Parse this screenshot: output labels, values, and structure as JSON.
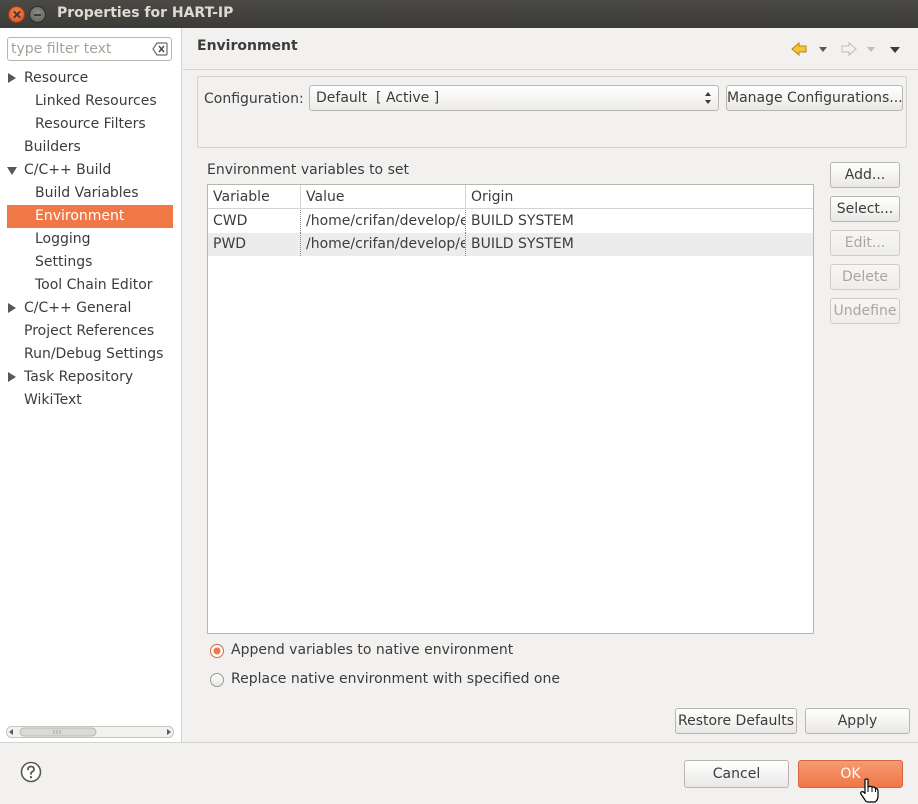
{
  "window": {
    "title": "Properties for HART-IP"
  },
  "filter": {
    "placeholder": "type filter text"
  },
  "tree": [
    {
      "label": "Resource",
      "level": 0,
      "expandable": true
    },
    {
      "label": "Linked Resources",
      "level": 1
    },
    {
      "label": "Resource Filters",
      "level": 1
    },
    {
      "label": "Builders",
      "level": 0
    },
    {
      "label": "C/C++ Build",
      "level": 0,
      "expandable": true
    },
    {
      "label": "Build Variables",
      "level": 1
    },
    {
      "label": "Environment",
      "level": 1,
      "selected": true
    },
    {
      "label": "Logging",
      "level": 1
    },
    {
      "label": "Settings",
      "level": 1
    },
    {
      "label": "Tool Chain Editor",
      "level": 1
    },
    {
      "label": "C/C++ General",
      "level": 0,
      "expandable": true
    },
    {
      "label": "Project References",
      "level": 0
    },
    {
      "label": "Run/Debug Settings",
      "level": 0
    },
    {
      "label": "Task Repository",
      "level": 0,
      "expandable": true
    },
    {
      "label": "WikiText",
      "level": 0
    }
  ],
  "page": {
    "title": "Environment",
    "configuration_label": "Configuration:",
    "configuration_value": "Default  [ Active ]",
    "manage_button": "Manage Configurations...",
    "section_label": "Environment variables to set",
    "columns": [
      "Variable",
      "Value",
      "Origin"
    ],
    "rows": [
      {
        "variable": "CWD",
        "value": "/home/crifan/develop/e",
        "origin": "BUILD SYSTEM"
      },
      {
        "variable": "PWD",
        "value": "/home/crifan/develop/e",
        "origin": "BUILD SYSTEM"
      }
    ],
    "side_buttons": {
      "add": "Add...",
      "select": "Select...",
      "edit": "Edit...",
      "delete": "Delete",
      "undefine": "Undefine"
    },
    "radio_append": "Append variables to native environment",
    "radio_replace": "Replace native environment with specified one",
    "restore_defaults": "Restore Defaults",
    "apply": "Apply"
  },
  "footer": {
    "cancel": "Cancel",
    "ok": "OK"
  },
  "colors": {
    "accent": "#f07746",
    "titlebar": "#3c3b37",
    "dialog_bg": "#f2f1f0"
  }
}
